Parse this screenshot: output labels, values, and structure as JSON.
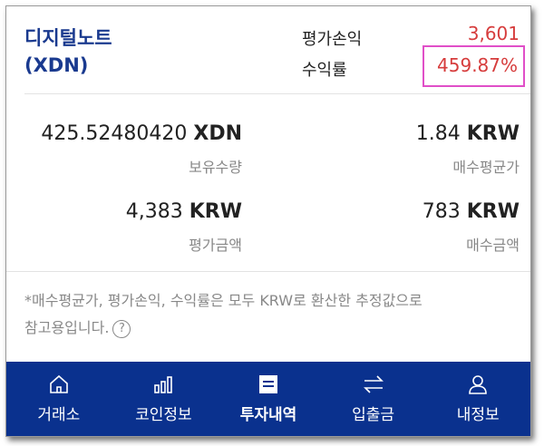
{
  "coin": {
    "name_kr": "디지털노트",
    "symbol_paren": "(XDN)"
  },
  "summary": {
    "profit_label": "평가손익",
    "profit_value": "3,601",
    "rate_label": "수익률",
    "rate_value": "459.87%"
  },
  "stats": {
    "holdings": {
      "value": "425.52480420",
      "unit": "XDN",
      "label": "보유수량"
    },
    "avg_price": {
      "value": "1.84",
      "unit": "KRW",
      "label": "매수평균가"
    },
    "eval_amount": {
      "value": "4,383",
      "unit": "KRW",
      "label": "평가금액"
    },
    "buy_amount": {
      "value": "783",
      "unit": "KRW",
      "label": "매수금액"
    }
  },
  "note": {
    "line1": "*매수평균가, 평가손익, 수익률은 모두 KRW로 환산한 추정값으로",
    "line2": "참고용입니다.",
    "help": "?"
  },
  "nav": [
    {
      "label": "거래소",
      "icon": "home-icon"
    },
    {
      "label": "코인정보",
      "icon": "bar-chart-icon"
    },
    {
      "label": "투자내역",
      "icon": "document-icon",
      "active": true
    },
    {
      "label": "입출금",
      "icon": "transfer-icon"
    },
    {
      "label": "내정보",
      "icon": "user-icon"
    }
  ],
  "colors": {
    "accent": "#0a318e",
    "profit": "#d63c3c",
    "highlight": "#e04fc8",
    "title": "#1a3a8f"
  }
}
